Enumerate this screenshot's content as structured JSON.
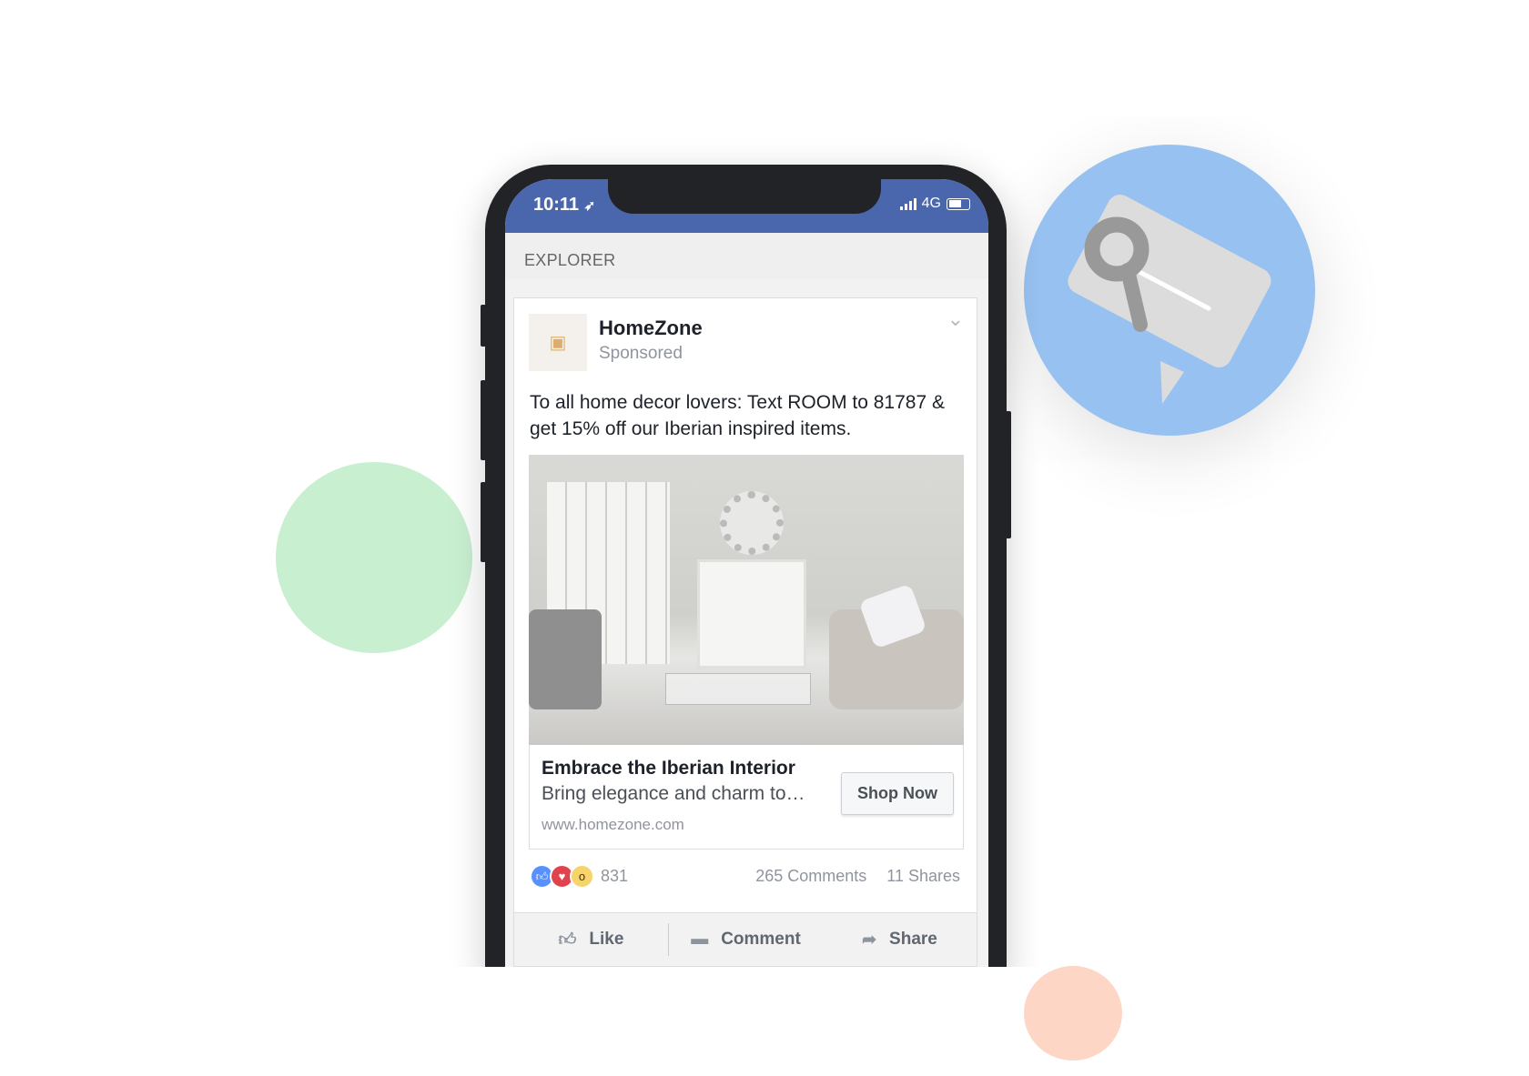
{
  "status_bar": {
    "time": "10:11",
    "network": "4G",
    "battery_level": 0.65
  },
  "header": {
    "title": "EXPLORER"
  },
  "post": {
    "page_name": "HomeZone",
    "label": "Sponsored",
    "message": "To all home decor lovers: Text ROOM to 81787 & get 15% off our Iberian inspired items.",
    "link": {
      "title": "Embrace the Iberian Interior",
      "description": "Bring elegance and charm to…",
      "url": "www.homezone.com",
      "cta": "Shop Now"
    },
    "reactions": {
      "count": "831",
      "comments": "265 Comments",
      "shares": "11 Shares"
    },
    "actions": {
      "like": "Like",
      "comment": "Comment",
      "share": "Share"
    }
  },
  "colors": {
    "facebook_blue": "#4a67ad",
    "green_circle": "#c9efd1",
    "blue_circle": "#97c1f0",
    "peach_circle": "#fdd6c6"
  },
  "icons": [
    "location-arrow-icon",
    "signal-icon",
    "battery-icon",
    "chevron-down-icon",
    "like-reaction-icon",
    "love-reaction-icon",
    "wow-reaction-icon",
    "thumbs-up-icon",
    "comment-icon",
    "share-arrow-icon",
    "keyword-bubble-icon"
  ]
}
